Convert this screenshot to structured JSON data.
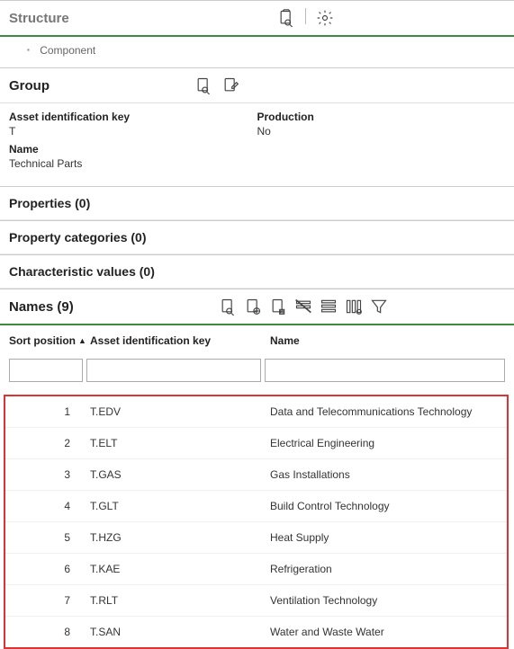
{
  "structure": {
    "title": "Structure",
    "breadcrumb": "Component"
  },
  "group": {
    "title": "Group",
    "fields": {
      "asset_id_label": "Asset identification key",
      "asset_id_value": "T",
      "production_label": "Production",
      "production_value": "No",
      "name_label": "Name",
      "name_value": "Technical Parts"
    }
  },
  "sections": {
    "properties": "Properties (0)",
    "property_categories": "Property categories (0)",
    "characteristic_values": "Characteristic values (0)",
    "names": "Names (9)"
  },
  "table": {
    "columns": {
      "sort": "Sort position",
      "key": "Asset identification key",
      "name": "Name"
    },
    "rows": [
      {
        "sort": "1",
        "key": "T.EDV",
        "name": "Data and Telecommunications Technology"
      },
      {
        "sort": "2",
        "key": "T.ELT",
        "name": "Electrical Engineering"
      },
      {
        "sort": "3",
        "key": "T.GAS",
        "name": "Gas Installations"
      },
      {
        "sort": "4",
        "key": "T.GLT",
        "name": "Build Control Technology"
      },
      {
        "sort": "5",
        "key": "T.HZG",
        "name": "Heat Supply"
      },
      {
        "sort": "6",
        "key": "T.KAE",
        "name": "Refrigeration"
      },
      {
        "sort": "7",
        "key": "T.RLT",
        "name": "Ventilation Technology"
      },
      {
        "sort": "8",
        "key": "T.SAN",
        "name": "Water and Waste Water"
      }
    ]
  }
}
